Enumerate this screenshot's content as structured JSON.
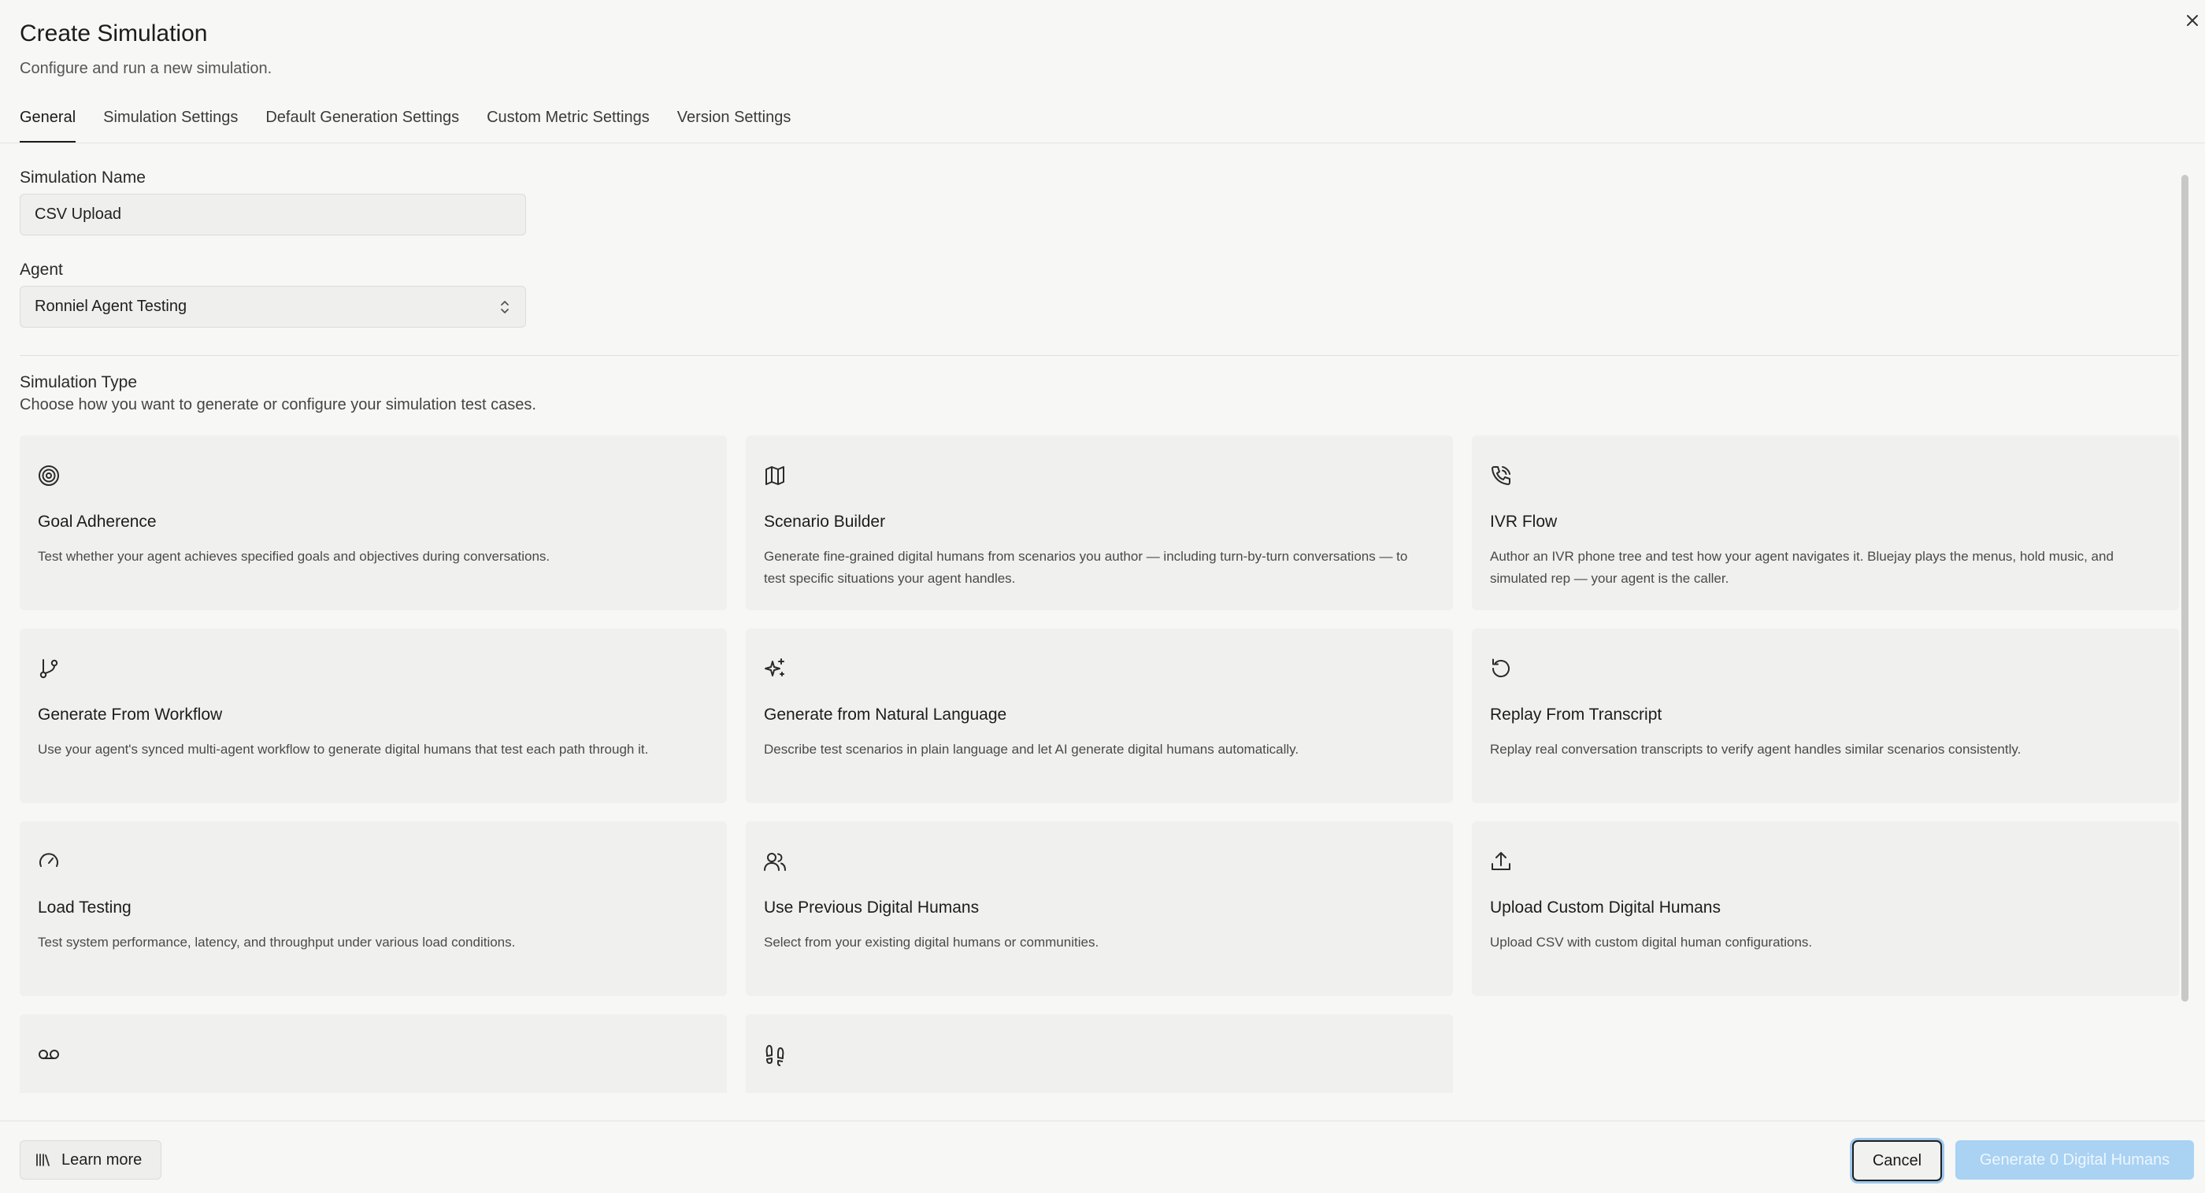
{
  "dialog": {
    "title": "Create Simulation",
    "subtitle": "Configure and run a new simulation."
  },
  "tabs": [
    {
      "label": "General",
      "active": true
    },
    {
      "label": "Simulation Settings",
      "active": false
    },
    {
      "label": "Default Generation Settings",
      "active": false
    },
    {
      "label": "Custom Metric Settings",
      "active": false
    },
    {
      "label": "Version Settings",
      "active": false
    }
  ],
  "form": {
    "name_label": "Simulation Name",
    "name_value": "CSV Upload",
    "agent_label": "Agent",
    "agent_value": "Ronniel Agent Testing"
  },
  "simulation_type": {
    "title": "Simulation Type",
    "subtitle": "Choose how you want to generate or configure your simulation test cases.",
    "cards": [
      {
        "icon": "target-icon",
        "title": "Goal Adherence",
        "desc": "Test whether your agent achieves specified goals and objectives during conversations."
      },
      {
        "icon": "map-icon",
        "title": "Scenario Builder",
        "desc": "Generate fine-grained digital humans from scenarios you author — including turn-by-turn conversations — to test specific situations your agent handles."
      },
      {
        "icon": "phone-icon",
        "title": "IVR Flow",
        "desc": "Author an IVR phone tree and test how your agent navigates it. Bluejay plays the menus, hold music, and simulated rep — your agent is the caller."
      },
      {
        "icon": "workflow-icon",
        "title": "Generate From Workflow",
        "desc": "Use your agent's synced multi-agent workflow to generate digital humans that test each path through it."
      },
      {
        "icon": "sparkles-icon",
        "title": "Generate from Natural Language",
        "desc": "Describe test scenarios in plain language and let AI generate digital humans automatically."
      },
      {
        "icon": "replay-icon",
        "title": "Replay From Transcript",
        "desc": "Replay real conversation transcripts to verify agent handles similar scenarios consistently."
      },
      {
        "icon": "gauge-icon",
        "title": "Load Testing",
        "desc": "Test system performance, latency, and throughput under various load conditions."
      },
      {
        "icon": "users-icon",
        "title": "Use Previous Digital Humans",
        "desc": "Select from your existing digital humans or communities."
      },
      {
        "icon": "upload-icon",
        "title": "Upload Custom Digital Humans",
        "desc": "Upload CSV with custom digital human configurations."
      },
      {
        "icon": "voicemail-icon",
        "title": "",
        "desc": ""
      },
      {
        "icon": "footprints-icon",
        "title": "",
        "desc": ""
      }
    ]
  },
  "footer": {
    "learn_more": "Learn more",
    "cancel": "Cancel",
    "generate": "Generate 0 Digital Humans"
  },
  "colors": {
    "background": "#f7f7f6",
    "card": "#f0f0ef",
    "primary_disabled": "#a9d2f3",
    "focus_ring": "#9ec7ee"
  }
}
